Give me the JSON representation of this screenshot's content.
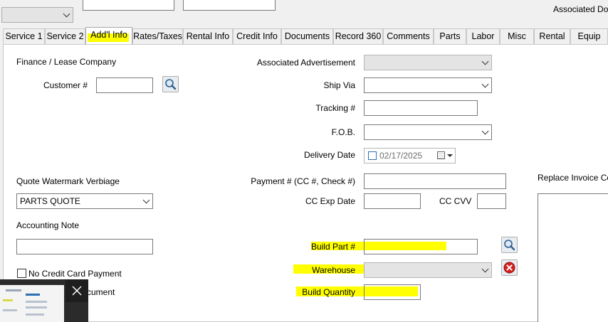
{
  "top": {
    "associated_doc_label": "Associated Doc"
  },
  "tabs": [
    {
      "label": "Service 1"
    },
    {
      "label": "Service 2"
    },
    {
      "label": "Add'l Info",
      "active": true
    },
    {
      "label": "Rates/Taxes"
    },
    {
      "label": "Rental Info"
    },
    {
      "label": "Credit Info"
    },
    {
      "label": "Documents"
    },
    {
      "label": "Record 360"
    },
    {
      "label": "Comments"
    },
    {
      "label": "Parts"
    },
    {
      "label": "Labor"
    },
    {
      "label": "Misc"
    },
    {
      "label": "Rental"
    },
    {
      "label": "Equip"
    }
  ],
  "left": {
    "finance_heading": "Finance / Lease Company",
    "customer_label": "Customer #",
    "customer_value": "",
    "watermark_label": "Quote Watermark Verbiage",
    "watermark_value": "PARTS QUOTE",
    "accounting_label": "Accounting Note",
    "accounting_value": "",
    "no_cc_label": "No Credit Card Payment",
    "document_label": "cument"
  },
  "right": {
    "assoc_ad_label": "Associated Advertisement",
    "ship_via_label": "Ship Via",
    "tracking_label": "Tracking #",
    "fob_label": "F.O.B.",
    "delivery_date_label": "Delivery Date",
    "delivery_date_value": "02/17/2025",
    "payment_label": "Payment # (CC #, Check #)",
    "cc_exp_label": "CC Exp Date",
    "cc_cvv_label": "CC CVV",
    "build_part_label": "Build Part #",
    "warehouse_label": "Warehouse",
    "build_qty_label": "Build Quantity",
    "replace_invoice_label": "Replace Invoice Co"
  },
  "colors": {
    "highlight": "#ffff00",
    "panel_bg": "#ffffff",
    "window_bg": "#f0f0f0"
  }
}
